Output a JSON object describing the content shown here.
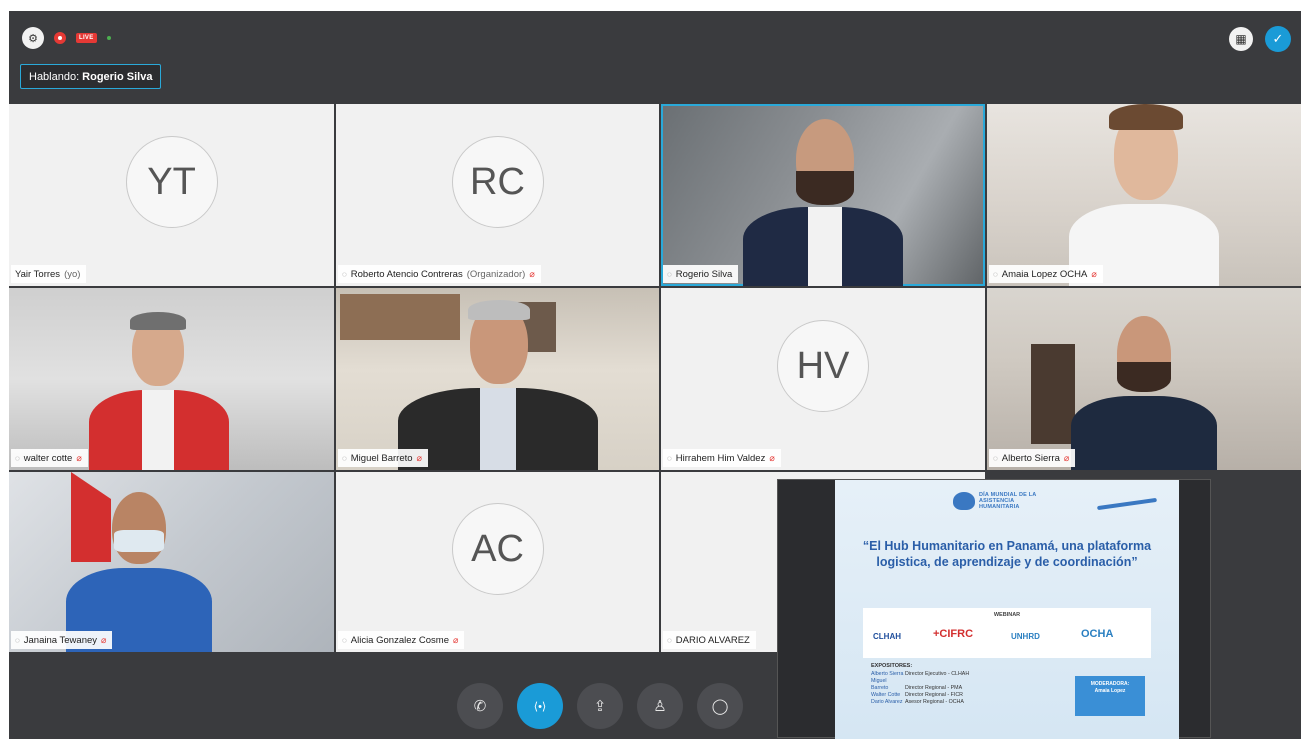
{
  "topbar": {
    "live_label": "LIVE",
    "speaking_label": "Hablando:",
    "speaking_name": "Rogerio Silva"
  },
  "participants": [
    {
      "initials": "YT",
      "name": "Yair Torres",
      "role": "(yo)"
    },
    {
      "initials": "RC",
      "name": "Roberto Atencio Contreras",
      "role": "(Organizador)"
    },
    {
      "name": "Rogerio Silva"
    },
    {
      "name": "Amaia Lopez OCHA"
    },
    {
      "name": "walter cotte"
    },
    {
      "name": "Miguel Barreto"
    },
    {
      "initials": "HV",
      "name": "Hirrahem Him Valdez"
    },
    {
      "name": "Alberto Sierra"
    },
    {
      "name": "Janaina Tewaney"
    },
    {
      "initials": "AC",
      "name": "Alicia Gonzalez Cosme"
    },
    {
      "name": "DARIO ALVAREZ"
    }
  ],
  "slide": {
    "logo_text": "DÍA MUNDIAL DE LA ASISTENCIA HUMANITARIA",
    "title": "“El Hub Humanitario en Panamá, una plataforma logistica, de aprendizaje y de coordinación”",
    "webinar_label": "WEBINAR",
    "partners": [
      "CLHAH",
      "+CIFRC",
      "UNHRD",
      "OCHA"
    ],
    "expositores_label": "EXPOSITORES:",
    "expositores": [
      {
        "name": "Alberto Sierra",
        "title": "Director Ejecutivo - CLHAH"
      },
      {
        "name": "Miguel Barreto",
        "title": "Director Regional - PMA"
      },
      {
        "name": "Walter Cotte",
        "title": "Director Regional - FICR"
      },
      {
        "name": "Dario Alvarez",
        "title": "Asesor Regional - OCHA"
      }
    ],
    "moderator_label": "MODERADORA:",
    "moderator_name": "Amaia Lopez"
  },
  "colors": {
    "accent": "#1a9bd7",
    "stage_bg": "#3a3b3e",
    "muted_red": "#e53935"
  },
  "icons": [
    "settings-icon",
    "record-icon",
    "layout-icon",
    "check-icon",
    "phone-icon",
    "bluetooth-icon",
    "share-icon",
    "participants-icon",
    "chat-icon",
    "microphone-icon",
    "muted-mic-icon"
  ]
}
